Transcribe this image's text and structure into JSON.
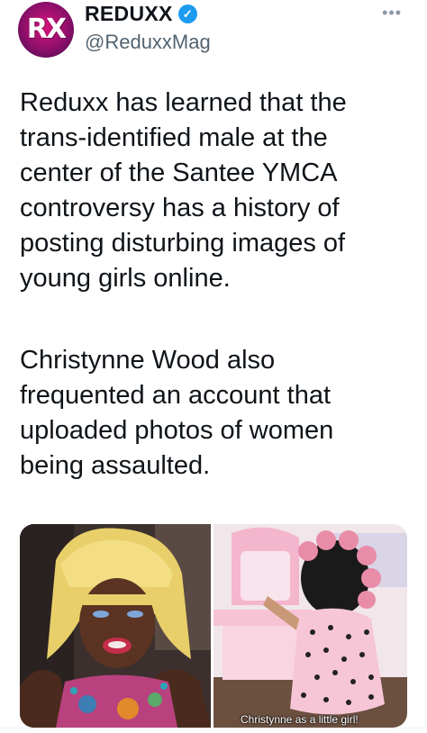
{
  "account": {
    "display_name": "REDUXX",
    "handle": "@ReduxxMag",
    "avatar_logo_text": "RX",
    "verified_icon": "check-icon",
    "more_icon": "ellipsis-icon"
  },
  "tweet": {
    "paragraph_1": "Reduxx has learned that the\ntrans-identified male at the\ncenter of the Santee YMCA\ncontroversy has a history of\nposting disturbing images of\nyoung girls online.",
    "paragraph_2": "Christynne Wood also\nfrequented an account that\nuploaded photos of women\nbeing assaulted."
  },
  "media": {
    "right_photo_caption": "Christynne as a little girl!"
  },
  "colors": {
    "verified_blue": "#1d9bf0",
    "text": "#0f1419",
    "secondary_text": "#536471",
    "avatar_magenta": "#d4147a"
  }
}
